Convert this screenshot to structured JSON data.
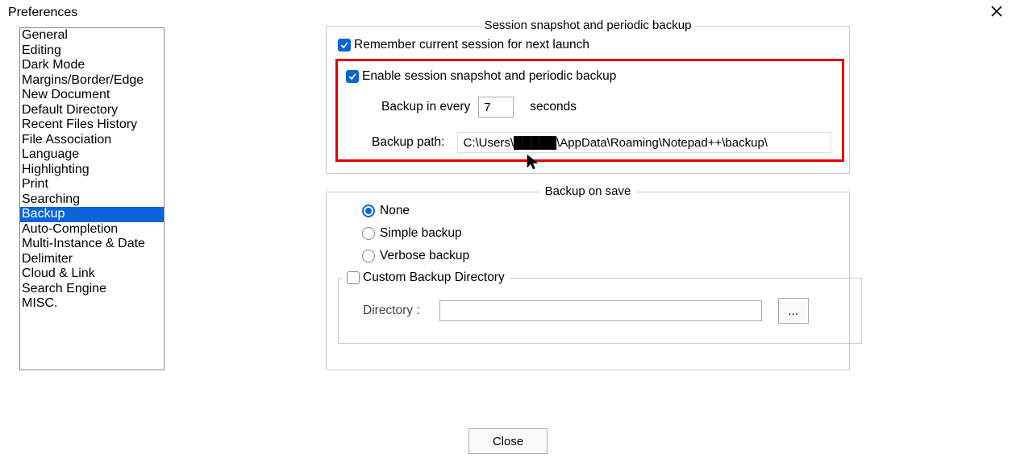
{
  "window": {
    "title": "Preferences",
    "close_button": "Close"
  },
  "sidebar": {
    "items": [
      "General",
      "Editing",
      "Dark Mode",
      "Margins/Border/Edge",
      "New Document",
      "Default Directory",
      "Recent Files History",
      "File Association",
      "Language",
      "Highlighting",
      "Print",
      "Searching",
      "Backup",
      "Auto-Completion",
      "Multi-Instance & Date",
      "Delimiter",
      "Cloud & Link",
      "Search Engine",
      "MISC."
    ],
    "selected_index": 12
  },
  "session_group": {
    "legend": "Session snapshot and periodic backup",
    "remember_label": "Remember current session for next launch",
    "remember_checked": true,
    "enable_label": "Enable session snapshot and periodic backup",
    "enable_checked": true,
    "backup_every_prefix": "Backup in every",
    "backup_every_value": "7",
    "backup_every_suffix": "seconds",
    "backup_path_label": "Backup path:",
    "backup_path_value": "C:\\Users\\█████\\AppData\\Roaming\\Notepad++\\backup\\"
  },
  "save_group": {
    "legend": "Backup on save",
    "options": [
      "None",
      "Simple backup",
      "Verbose backup"
    ],
    "selected_index": 0,
    "custom_dir_label": "Custom Backup Directory",
    "custom_dir_checked": false,
    "directory_label": "Directory :",
    "directory_value": "",
    "browse_label": "..."
  }
}
